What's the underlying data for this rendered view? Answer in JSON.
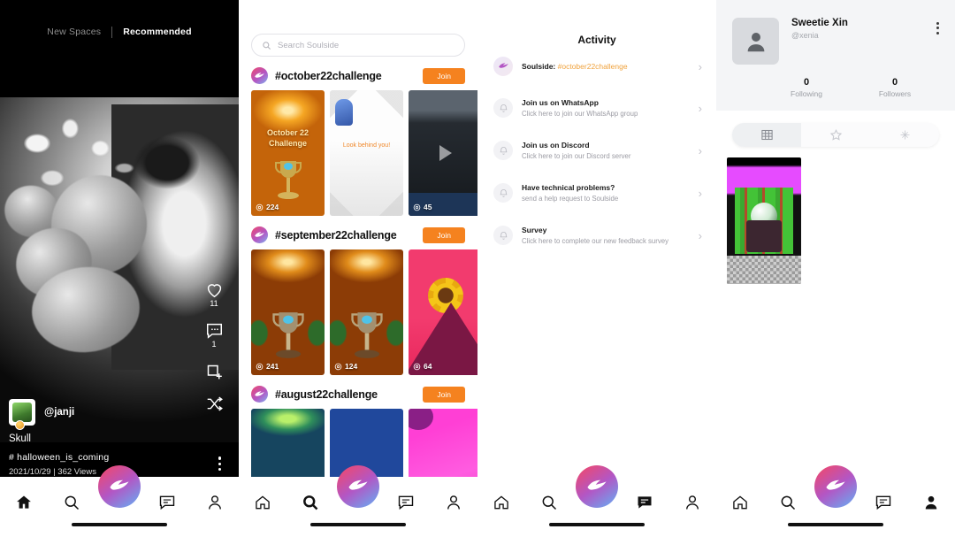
{
  "feed_panel": {
    "tabs": [
      {
        "label": "New Spaces",
        "active": false
      },
      {
        "label": "Recommended",
        "active": true
      }
    ],
    "post": {
      "username": "@janji",
      "title": "Skull",
      "hashtag": "# halloween_is_coming",
      "meta": "2021/10/29 | 362 Views",
      "likes": "11",
      "comments": "1",
      "like_icon": "heart-icon",
      "comment_icon": "comment-icon",
      "save_icon": "add-to-space-icon",
      "shuffle_icon": "shuffle-icon",
      "more_icon": "more-vertical-icon"
    },
    "nav": [
      {
        "name": "home",
        "icon": "home-icon",
        "active": true
      },
      {
        "name": "search",
        "icon": "search-icon",
        "active": false
      },
      {
        "name": "create",
        "icon": "butterfly-logo-icon",
        "active": false
      },
      {
        "name": "messages",
        "icon": "chat-icon",
        "active": false
      },
      {
        "name": "profile",
        "icon": "person-icon",
        "active": false
      }
    ]
  },
  "discover_panel": {
    "search": {
      "placeholder": "Search Soulside",
      "icon": "search-icon"
    },
    "challenges": [
      {
        "title": "#october22challenge",
        "join_label": "Join",
        "logo_icon": "butterfly-logo-icon",
        "thumbs": [
          {
            "views": "224",
            "caption": "October 22 Challenge",
            "overlay": "CS0"
          },
          {
            "views": "",
            "caption": "Look behind you!"
          },
          {
            "views": "45",
            "caption": ""
          }
        ]
      },
      {
        "title": "#september22challenge",
        "join_label": "Join",
        "logo_icon": "butterfly-logo-icon",
        "thumbs": [
          {
            "views": "241",
            "caption": ""
          },
          {
            "views": "124",
            "caption": ""
          },
          {
            "views": "64",
            "caption": ""
          }
        ]
      },
      {
        "title": "#august22challenge",
        "join_label": "Join",
        "logo_icon": "butterfly-logo-icon",
        "thumbs": [
          {
            "views": "",
            "caption": ""
          },
          {
            "views": "",
            "caption": ""
          },
          {
            "views": "",
            "caption": ""
          }
        ]
      }
    ],
    "nav": [
      {
        "name": "home",
        "icon": "home-icon",
        "active": false
      },
      {
        "name": "search",
        "icon": "search-icon",
        "active": true
      },
      {
        "name": "create",
        "icon": "butterfly-logo-icon",
        "active": false
      },
      {
        "name": "messages",
        "icon": "chat-icon",
        "active": false
      },
      {
        "name": "profile",
        "icon": "person-icon",
        "active": false
      }
    ]
  },
  "activity_panel": {
    "title": "Activity",
    "items": [
      {
        "icon": "butterfly-logo-icon",
        "primary": "Soulside:",
        "highlight": "#october22challenge",
        "secondary": "",
        "chevron": "chevron-right-icon"
      },
      {
        "icon": "bell-icon",
        "primary": "Join us on WhatsApp",
        "highlight": "",
        "secondary": "Click here to join our WhatsApp group",
        "chevron": "chevron-right-icon"
      },
      {
        "icon": "bell-icon",
        "primary": "Join us on Discord",
        "highlight": "",
        "secondary": "Click here to join our Discord server",
        "chevron": "chevron-right-icon"
      },
      {
        "icon": "bell-icon",
        "primary": "Have technical problems?",
        "highlight": "",
        "secondary": "send a help request to Soulside",
        "chevron": "chevron-right-icon"
      },
      {
        "icon": "bell-icon",
        "primary": "Survey",
        "highlight": "",
        "secondary": "Click here to complete our new feedback survey",
        "chevron": "chevron-right-icon"
      }
    ],
    "nav": [
      {
        "name": "home",
        "icon": "home-icon",
        "active": false
      },
      {
        "name": "search",
        "icon": "search-icon",
        "active": false
      },
      {
        "name": "create",
        "icon": "butterfly-logo-icon",
        "active": false
      },
      {
        "name": "messages",
        "icon": "chat-icon",
        "active": true
      },
      {
        "name": "profile",
        "icon": "person-icon",
        "active": false
      }
    ]
  },
  "profile_panel": {
    "name": "Sweetie Xin",
    "handle": "@xenia",
    "avatar_icon": "person-avatar-icon",
    "more_icon": "more-vertical-icon",
    "stats": [
      {
        "value": "0",
        "label": "Following"
      },
      {
        "value": "0",
        "label": "Followers"
      }
    ],
    "tabs": [
      {
        "icon": "grid-icon",
        "selected": true
      },
      {
        "icon": "star-icon",
        "selected": false
      },
      {
        "icon": "sparkle-icon",
        "selected": false
      }
    ],
    "posts": [
      {
        "views": ""
      }
    ],
    "nav": [
      {
        "name": "home",
        "icon": "home-icon",
        "active": false
      },
      {
        "name": "search",
        "icon": "search-icon",
        "active": false
      },
      {
        "name": "create",
        "icon": "butterfly-logo-icon",
        "active": false
      },
      {
        "name": "messages",
        "icon": "chat-icon",
        "active": false
      },
      {
        "name": "profile",
        "icon": "person-icon",
        "active": true
      }
    ]
  },
  "colors": {
    "accent_orange": "#f5821f",
    "brand_gradient_start": "#f0486c",
    "brand_gradient_mid": "#b356c4",
    "brand_gradient_end": "#6aa8f0",
    "highlight_text": "#f0a23c"
  }
}
